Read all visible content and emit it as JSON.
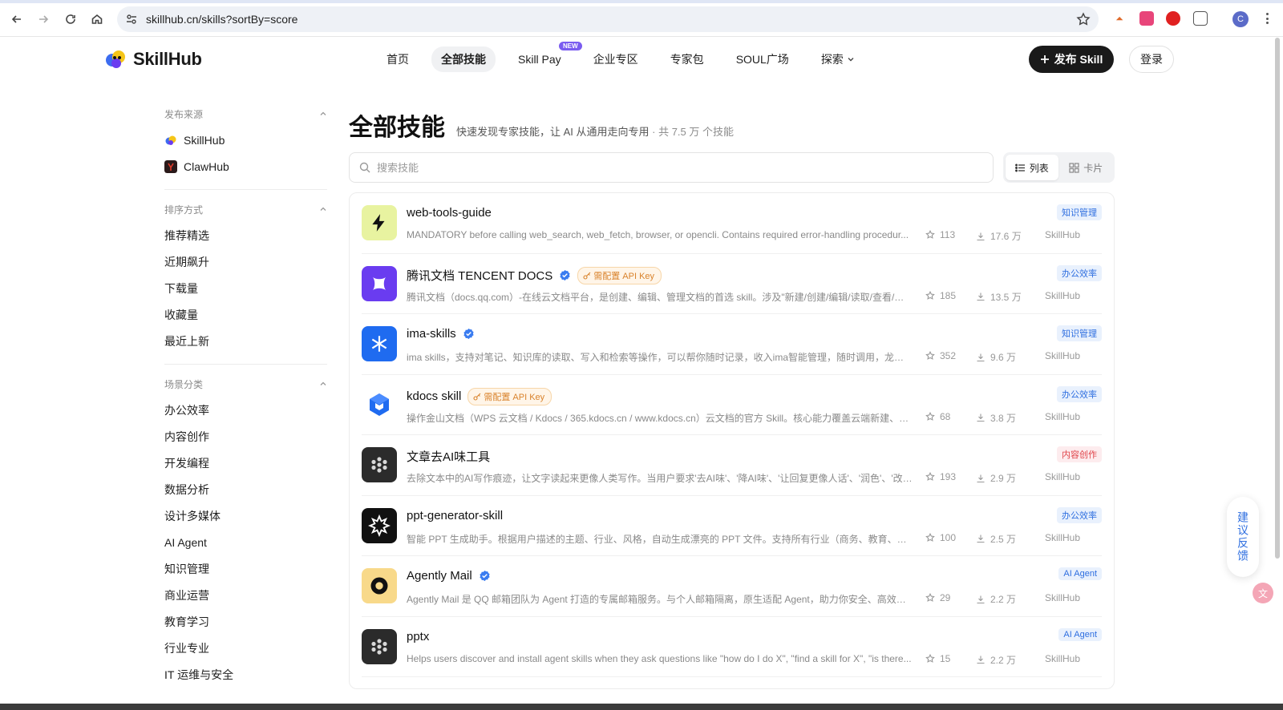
{
  "browser": {
    "url": "skillhub.cn/skills?sortBy=score",
    "profile_initial": "C"
  },
  "header": {
    "logo_text": "SkillHub",
    "nav": [
      {
        "label": "首页",
        "active": false
      },
      {
        "label": "全部技能",
        "active": true
      },
      {
        "label": "Skill Pay",
        "active": false,
        "badge": "NEW"
      },
      {
        "label": "企业专区",
        "active": false
      },
      {
        "label": "专家包",
        "active": false
      },
      {
        "label": "SOUL广场",
        "active": false
      },
      {
        "label": "探索",
        "active": false
      }
    ],
    "publish_label": "发布 Skill",
    "login_label": "登录"
  },
  "sidebar": {
    "source": {
      "title": "发布来源",
      "items": [
        "SkillHub",
        "ClawHub"
      ]
    },
    "sort": {
      "title": "排序方式",
      "items": [
        "推荐精选",
        "近期飙升",
        "下载量",
        "收藏量",
        "最近上新"
      ]
    },
    "category": {
      "title": "场景分类",
      "items": [
        "办公效率",
        "内容创作",
        "开发编程",
        "数据分析",
        "设计多媒体",
        "AI Agent",
        "知识管理",
        "商业运营",
        "教育学习",
        "行业专业",
        "IT 运维与安全"
      ]
    }
  },
  "main": {
    "title": "全部技能",
    "subtitle": "快速发现专家技能，让 AI 从通用走向专用",
    "count_text": "· 共 7.5 万 个技能",
    "search_placeholder": "搜索技能",
    "view_list": "列表",
    "view_card": "卡片",
    "skills": [
      {
        "name": "web-tools-guide",
        "verified": false,
        "api_key": "",
        "desc": "MANDATORY before calling web_search, web_fetch, browser, or opencli. Contains required error-handling procedur...",
        "stars": "113",
        "downloads": "17.6 万",
        "source": "SkillHub",
        "category": "知识管理",
        "cat_color": "blue",
        "icon": "bolt-icon",
        "icon_bg": "#e8f3a0"
      },
      {
        "name": "腾讯文档 TENCENT DOCS",
        "verified": true,
        "api_key": "需配置 API Key",
        "desc": "腾讯文档（docs.qq.com）-在线云文档平台，是创建、编辑、管理文档的首选 skill。涉及\"新建/创建/编辑/读取/查看/搜索...",
        "stars": "185",
        "downloads": "13.5 万",
        "source": "SkillHub",
        "category": "办公效率",
        "cat_color": "blue",
        "icon": "tencent-docs-icon",
        "icon_bg": "#6a3cf0"
      },
      {
        "name": "ima-skills",
        "verified": true,
        "api_key": "",
        "desc": "ima skills，支持对笔记、知识库的读取、写入和检索等操作，可以帮你随时记录，收入ima智能管理，随时调用，龙虾输出...",
        "stars": "352",
        "downloads": "9.6 万",
        "source": "SkillHub",
        "category": "知识管理",
        "cat_color": "blue",
        "icon": "ima-icon",
        "icon_bg": "#1f6bf0"
      },
      {
        "name": "kdocs skill",
        "verified": false,
        "api_key": "需配置 API Key",
        "desc": "操作金山文档（WPS 云文档 / Kdocs / 365.kdocs.cn / www.kdocs.cn）云文档的官方 Skill。核心能力覆盖云端新建、读...",
        "stars": "68",
        "downloads": "3.8 万",
        "source": "SkillHub",
        "category": "办公效率",
        "cat_color": "blue",
        "icon": "kdocs-icon",
        "icon_bg": "#ffffff"
      },
      {
        "name": "文章去AI味工具",
        "verified": false,
        "api_key": "",
        "desc": "去除文本中的AI写作痕迹，让文字读起来更像人类写作。当用户要求'去AI味'、'降AI味'、'让回复更像人话'、'润色'、'改写...",
        "stars": "193",
        "downloads": "2.9 万",
        "source": "SkillHub",
        "category": "内容创作",
        "cat_color": "red",
        "icon": "flower-icon",
        "icon_bg": "#2b2b2b"
      },
      {
        "name": "ppt-generator-skill",
        "verified": false,
        "api_key": "",
        "desc": "智能 PPT 生成助手。根据用户描述的主题、行业、风格，自动生成漂亮的 PPT 文件。支持所有行业（商务、教育、科技、...",
        "stars": "100",
        "downloads": "2.5 万",
        "source": "SkillHub",
        "category": "办公效率",
        "cat_color": "blue",
        "icon": "starburst-icon",
        "icon_bg": "#111111"
      },
      {
        "name": "Agently Mail",
        "verified": true,
        "api_key": "",
        "desc": "Agently Mail 是 QQ 邮箱团队为 Agent 打造的专属邮箱服务。与个人邮箱隔离，原生适配 Agent，助力你安全、高效地使...",
        "stars": "29",
        "downloads": "2.2 万",
        "source": "SkillHub",
        "category": "AI Agent",
        "cat_color": "blue",
        "icon": "ring-icon",
        "icon_bg": "#f8d98a"
      },
      {
        "name": "pptx",
        "verified": false,
        "api_key": "",
        "desc": "Helps users discover and install agent skills when they ask questions like \"how do I do X\", \"find a skill for X\", \"is there...",
        "stars": "15",
        "downloads": "2.2 万",
        "source": "SkillHub",
        "category": "AI Agent",
        "cat_color": "blue",
        "icon": "flower-icon",
        "icon_bg": "#2b2b2b"
      }
    ]
  },
  "feedback_label": "建议反馈"
}
